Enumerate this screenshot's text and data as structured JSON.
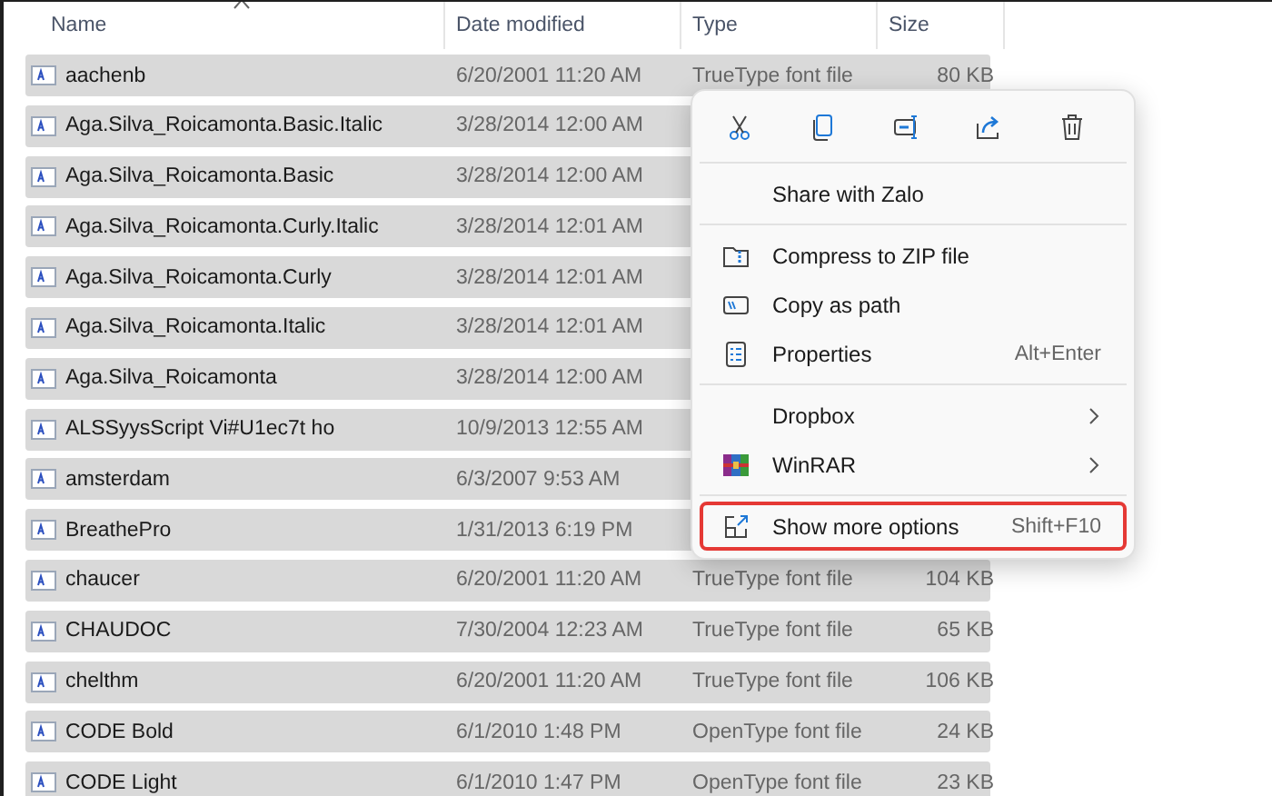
{
  "columns": [
    {
      "label": "Name"
    },
    {
      "label": "Date modified"
    },
    {
      "label": "Type"
    },
    {
      "label": "Size"
    }
  ],
  "files": [
    {
      "name": "aachenb",
      "date": "6/20/2001 11:20 AM",
      "type": "TrueType font file",
      "size": "80 KB",
      "selected": true
    },
    {
      "name": "Aga.Silva_Roicamonta.Basic.Italic",
      "date": "3/28/2014 12:00 AM",
      "selected": true
    },
    {
      "name": "Aga.Silva_Roicamonta.Basic",
      "date": "3/28/2014 12:00 AM",
      "selected": true
    },
    {
      "name": "Aga.Silva_Roicamonta.Curly.Italic",
      "date": "3/28/2014 12:01 AM",
      "selected": true
    },
    {
      "name": "Aga.Silva_Roicamonta.Curly",
      "date": "3/28/2014 12:01 AM",
      "selected": true
    },
    {
      "name": "Aga.Silva_Roicamonta.Italic",
      "date": "3/28/2014 12:01 AM",
      "selected": true
    },
    {
      "name": "Aga.Silva_Roicamonta",
      "date": "3/28/2014 12:00 AM",
      "selected": true
    },
    {
      "name": "ALSSyysScript Vi#U1ec7t ho",
      "date": "10/9/2013 12:55 AM",
      "selected": true
    },
    {
      "name": "amsterdam",
      "date": "6/3/2007 9:53 AM",
      "selected": true
    },
    {
      "name": "BreathePro",
      "date": "1/31/2013 6:19 PM",
      "selected": true
    },
    {
      "name": "chaucer",
      "date": "6/20/2001 11:20 AM",
      "type": "TrueType font file",
      "size": "104 KB",
      "selected": true
    },
    {
      "name": "CHAUDOC",
      "date": "7/30/2004 12:23 AM",
      "type": "TrueType font file",
      "size": "65 KB",
      "selected": true
    },
    {
      "name": "chelthm",
      "date": "6/20/2001 11:20 AM",
      "type": "TrueType font file",
      "size": "106 KB",
      "selected": true
    },
    {
      "name": "CODE Bold",
      "date": "6/1/2010 1:48 PM",
      "type": "OpenType font file",
      "size": "24 KB",
      "selected": true
    },
    {
      "name": "CODE Light",
      "date": "6/1/2010 1:47 PM",
      "type": "OpenType font file",
      "size": "23 KB",
      "selected": true
    }
  ],
  "context_menu": {
    "items": [
      {
        "kind": "separator"
      },
      {
        "kind": "item",
        "label": "Share with Zalo",
        "highlighted": false,
        "submenu": false
      },
      {
        "kind": "separator"
      },
      {
        "kind": "item",
        "label": "Compress to ZIP file",
        "highlighted": false,
        "submenu": false
      },
      {
        "kind": "item",
        "label": "Copy as path",
        "highlighted": false,
        "submenu": false
      },
      {
        "kind": "item",
        "label": "Properties",
        "shortcut": "Alt+Enter",
        "highlighted": false,
        "submenu": false
      },
      {
        "kind": "separator"
      },
      {
        "kind": "item",
        "label": "Dropbox",
        "highlighted": false,
        "submenu": true
      },
      {
        "kind": "item",
        "label": "WinRAR",
        "highlighted": false,
        "submenu": true
      },
      {
        "kind": "separator"
      },
      {
        "kind": "item",
        "label": "Show more options",
        "shortcut": "Shift+F10",
        "highlighted": true,
        "submenu": false
      }
    ]
  }
}
